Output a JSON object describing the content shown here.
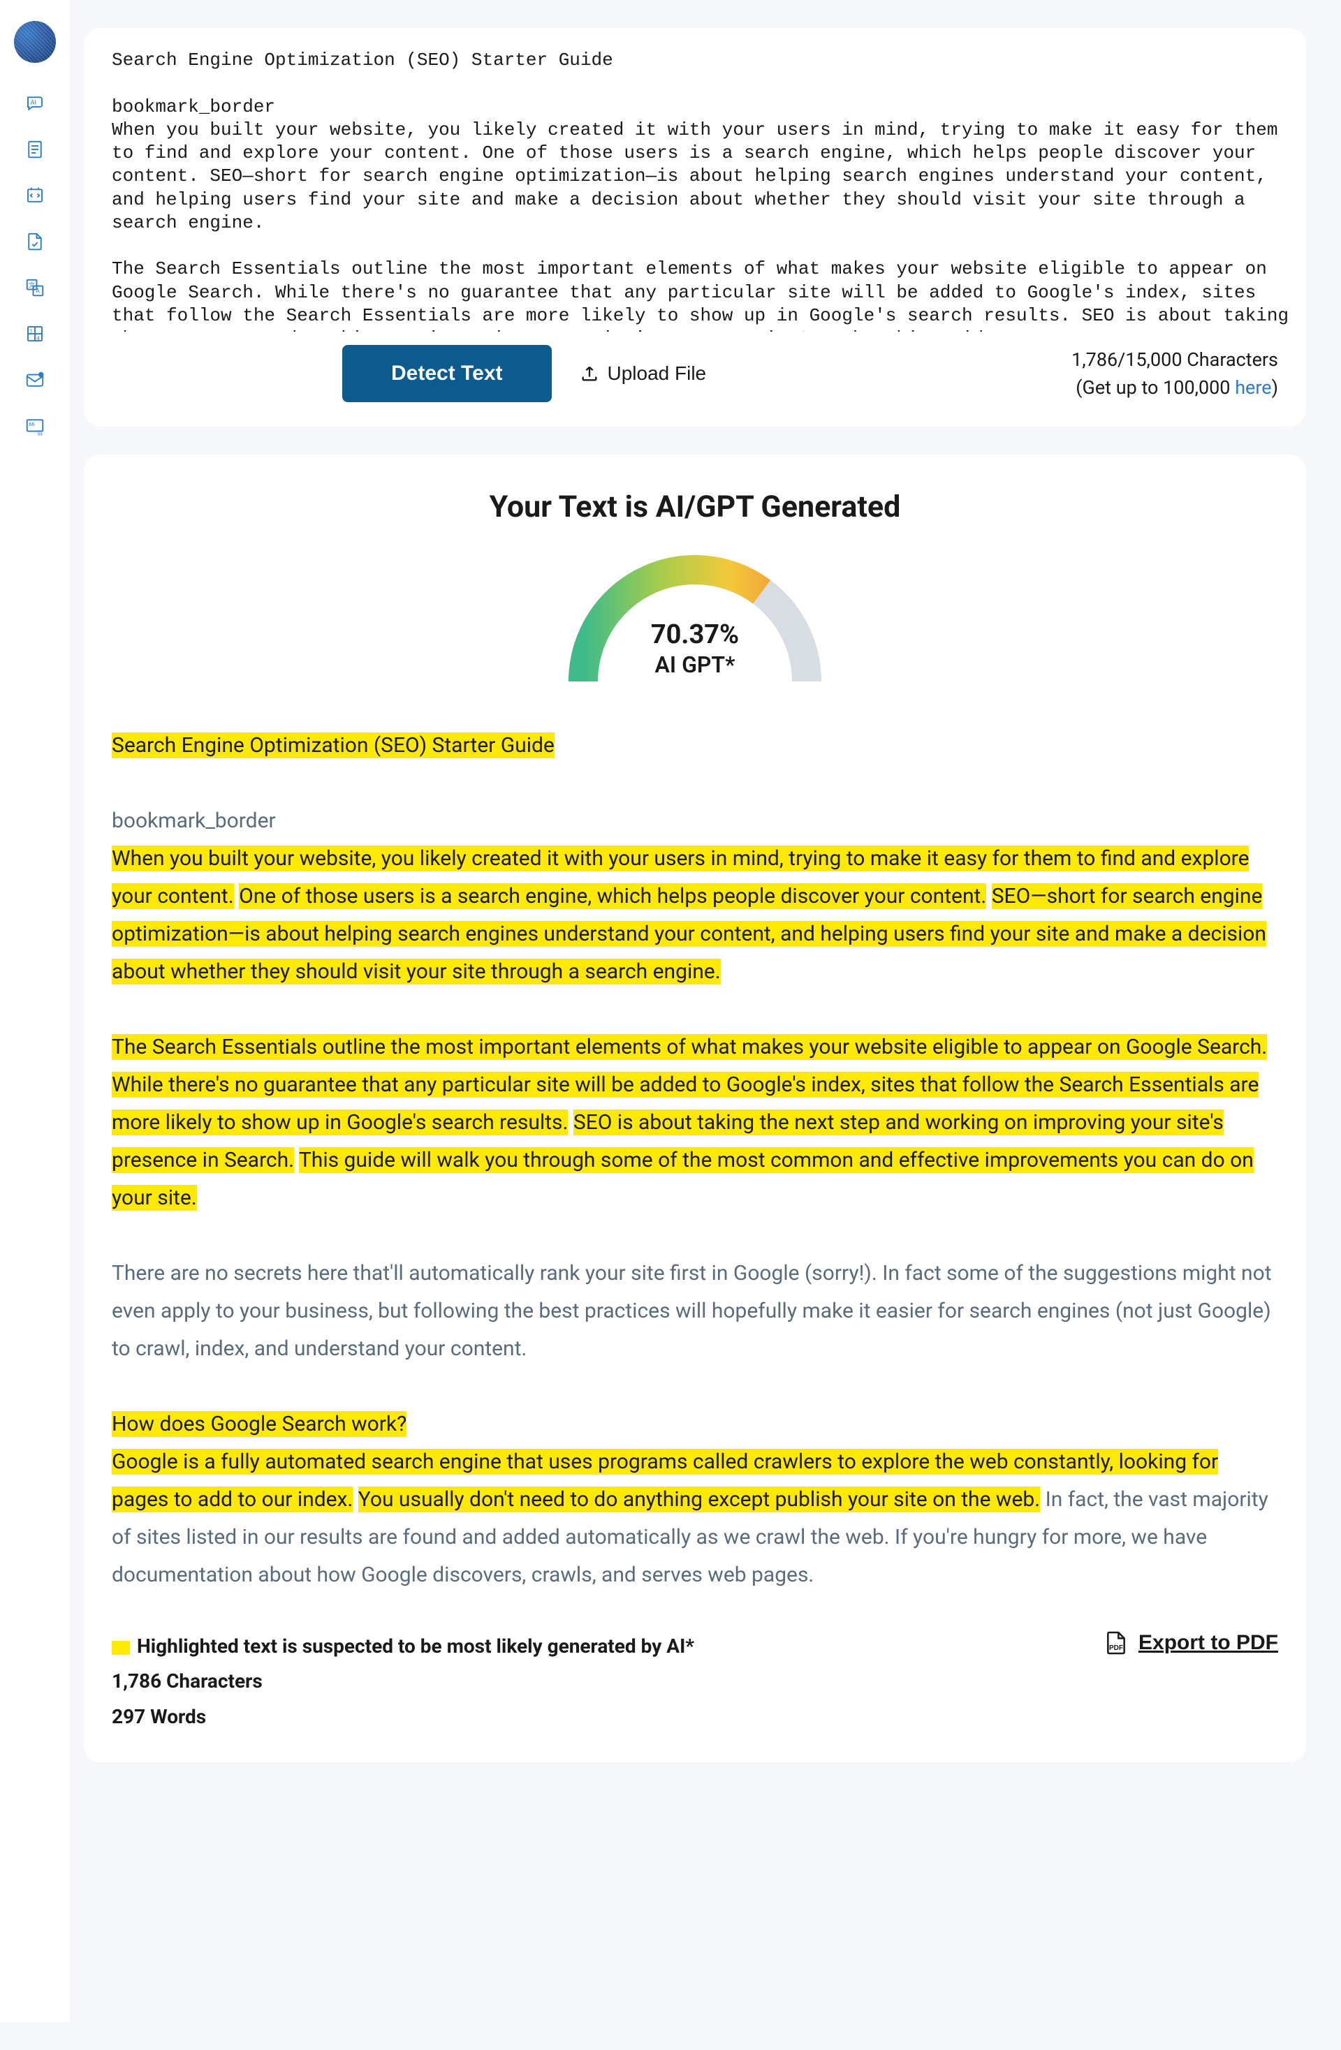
{
  "sidebar": {
    "logo_name": "brain-logo",
    "icons": [
      {
        "name": "ai-chat-icon"
      },
      {
        "name": "document-lines-icon"
      },
      {
        "name": "code-analysis-icon"
      },
      {
        "name": "document-check-icon"
      },
      {
        "name": "translate-icon"
      },
      {
        "name": "number-grid-icon"
      },
      {
        "name": "mail-icon"
      },
      {
        "name": "quote-card-icon"
      }
    ]
  },
  "input_card": {
    "text_content": "Search Engine Optimization (SEO) Starter Guide\n\nbookmark_border\nWhen you built your website, you likely created it with your users in mind, trying to make it easy for them to find and explore your content. One of those users is a search engine, which helps people discover your content. SEO—short for search engine optimization—is about helping search engines understand your content, and helping users find your site and make a decision about whether they should visit your site through a search engine.\n\nThe Search Essentials outline the most important elements of what makes your website eligible to appear on Google Search. While there's no guarantee that any particular site will be added to Google's index, sites that follow the Search Essentials are more likely to show up in Google's search results. SEO is about taking the next step and working on improving your site's presence in Search. This guide",
    "detect_button": "Detect Text",
    "upload_button": "Upload File",
    "char_count": "1,786/15,000 Characters",
    "upgrade_prefix": "(Get up to 100,000 ",
    "upgrade_link": "here",
    "upgrade_suffix": ")"
  },
  "result": {
    "heading": "Your Text is AI/GPT Generated",
    "gauge_percent": "70.37%",
    "gauge_label": "AI GPT*",
    "gauge_fill_ratio": 0.7037,
    "segments": [
      {
        "text": "Search Engine Optimization (SEO) Starter Guide",
        "hl": true,
        "br_after": true
      },
      {
        "text": "",
        "br_after": true
      },
      {
        "text": "bookmark_border",
        "hl": false,
        "br_after": true
      },
      {
        "text": "When you built your website, you likely created it with your users in mind, trying to make it easy for them to find and explore your content.",
        "hl": true
      },
      {
        "text": " ",
        "hl": false
      },
      {
        "text": "One of those users is a search engine, which helps people discover your content.",
        "hl": true
      },
      {
        "text": " ",
        "hl": false
      },
      {
        "text": "SEO—short for search engine optimization—is about helping search engines understand your content, and helping users find your site and make a decision about whether they should visit your site through a search engine.",
        "hl": true,
        "br_after": true
      },
      {
        "text": "",
        "br_after": true
      },
      {
        "text": "The Search Essentials outline the most important elements of what makes your website eligible to appear on Google Search.",
        "hl": true
      },
      {
        "text": " ",
        "hl": false
      },
      {
        "text": "While there's no guarantee that any particular site will be added to Google's index, sites that follow the Search Essentials are more likely to show up in Google's search results.",
        "hl": true
      },
      {
        "text": " ",
        "hl": false
      },
      {
        "text": "SEO is about taking the next step and working on improving your site's presence in Search.",
        "hl": true
      },
      {
        "text": " ",
        "hl": false
      },
      {
        "text": "This guide will walk you through some of the most common and effective improvements you can do on your site.",
        "hl": true,
        "br_after": true
      },
      {
        "text": "",
        "br_after": true
      },
      {
        "text": "There are no secrets here that'll automatically rank your site first in Google (sorry!). In fact some of the suggestions might not even apply to your business, but following the best practices will hopefully make it easier for search engines (not just Google) to crawl, index, and understand your content.",
        "hl": false,
        "br_after": true
      },
      {
        "text": "",
        "br_after": true
      },
      {
        "text": "How does Google Search work?",
        "hl": true,
        "br_after": true
      },
      {
        "text": "Google is a fully automated search engine that uses programs called crawlers to explore the web constantly, looking for pages to add to our index.",
        "hl": true
      },
      {
        "text": " ",
        "hl": false
      },
      {
        "text": "You usually don't need to do anything except publish your site on the web.",
        "hl": true
      },
      {
        "text": " In fact, the vast majority of sites listed in our results are found and added automatically as we crawl the web. If you're hungry for more, we have documentation about how Google discovers, crawls, and serves web pages.",
        "hl": false
      }
    ],
    "legend_text": "Highlighted text is suspected to be most likely generated by AI*",
    "stats_chars": "1,786 Characters",
    "stats_words": "297 Words",
    "export_label": "Export to PDF"
  }
}
